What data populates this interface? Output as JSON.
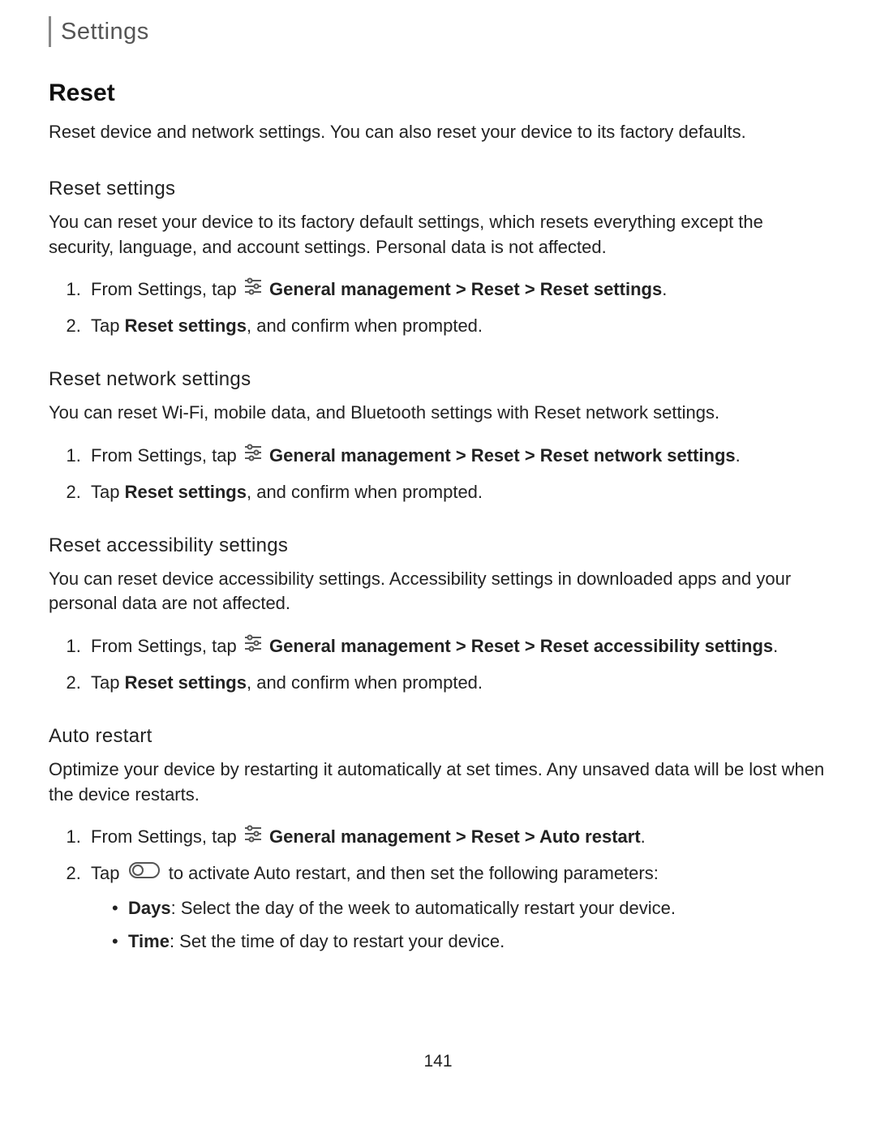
{
  "header": {
    "title": "Settings"
  },
  "main": {
    "title": "Reset",
    "intro": "Reset device and network settings. You can also reset your device to its factory defaults."
  },
  "sections": {
    "reset_settings": {
      "title": "Reset settings",
      "para": "You can reset your device to its factory default settings, which resets everything except the security, language, and account settings. Personal data is not affected.",
      "step1_prefix": "From Settings, tap ",
      "step1_path": "General management > Reset > Reset settings",
      "step1_suffix": ".",
      "step2_prefix": "Tap ",
      "step2_bold": "Reset settings",
      "step2_suffix": ", and confirm when prompted."
    },
    "reset_network": {
      "title": "Reset network settings",
      "para": "You can reset Wi-Fi, mobile data, and Bluetooth settings with Reset network settings.",
      "step1_prefix": "From Settings, tap ",
      "step1_path": "General management > Reset > Reset network settings",
      "step1_suffix": ".",
      "step2_prefix": "Tap ",
      "step2_bold": "Reset settings",
      "step2_suffix": ", and confirm when prompted."
    },
    "reset_accessibility": {
      "title": "Reset accessibility settings",
      "para": "You can reset device accessibility settings. Accessibility settings in downloaded apps and your personal data are not affected.",
      "step1_prefix": "From Settings, tap ",
      "step1_path": "General management > Reset > Reset accessibility settings",
      "step1_suffix": ".",
      "step2_prefix": "Tap ",
      "step2_bold": "Reset settings",
      "step2_suffix": ", and confirm when prompted."
    },
    "auto_restart": {
      "title": "Auto restart",
      "para": "Optimize your device by restarting it automatically at set times. Any unsaved data will be lost when the device restarts.",
      "step1_prefix": "From Settings, tap ",
      "step1_path": "General management > Reset > Auto restart",
      "step1_suffix": ".",
      "step2_prefix": "Tap ",
      "step2_suffix": " to activate Auto restart, and then set the following parameters:",
      "bullet1_bold": "Days",
      "bullet1_rest": ": Select the day of the week to automatically restart your device.",
      "bullet2_bold": "Time",
      "bullet2_rest": ": Set the time of day to restart your device."
    }
  },
  "pagenum": "141"
}
